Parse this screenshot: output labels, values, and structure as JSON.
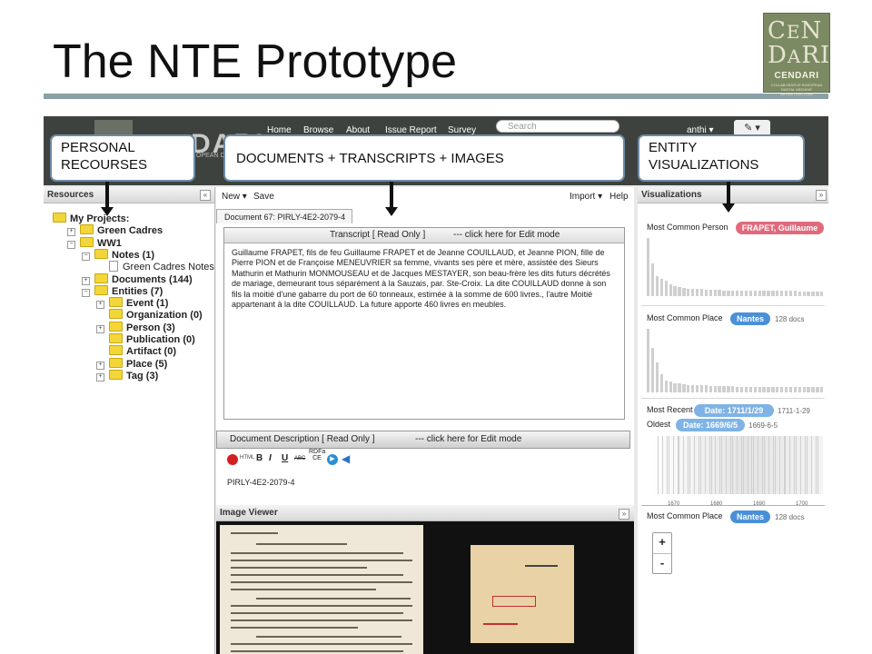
{
  "slide": {
    "title": "The NTE Prototype",
    "logo_word": "CENDARI",
    "logo_sub": "COLLABORATIVE EUROPEAN DIGITAL ARCHIVE INFRASTRUCTURE"
  },
  "app": {
    "brand_text": "DARI",
    "brand_sub": "OPEAN DIGITAL CTURE",
    "nav": [
      "Home",
      "Browse",
      "About",
      "Issue Report",
      "Survey"
    ],
    "search_placeholder": "Search",
    "user": "anthi ▾",
    "edit_button": "✎ ▾"
  },
  "callouts": {
    "personal": "PERSONAL RECOURSES",
    "documents": "DOCUMENTS + TRANSCRIPTS + IMAGES",
    "entity": "ENTITY VISUALIZATIONS"
  },
  "resources": {
    "header": "Resources",
    "collapse": "«",
    "tree": [
      {
        "label": "My Projects:",
        "level": 0,
        "kind": "folder",
        "toggle": ""
      },
      {
        "label": "Green Cadres",
        "level": 1,
        "kind": "folder",
        "toggle": "+"
      },
      {
        "label": "WW1",
        "level": 1,
        "kind": "folder",
        "toggle": "−"
      },
      {
        "label": "Notes (1)",
        "level": 2,
        "kind": "folder",
        "toggle": "−"
      },
      {
        "label": "Green Cadres Notes",
        "level": 3,
        "kind": "doc",
        "toggle": ""
      },
      {
        "label": "Documents (144)",
        "level": 2,
        "kind": "folder",
        "toggle": "+"
      },
      {
        "label": "Entities (7)",
        "level": 2,
        "kind": "folder",
        "toggle": "−"
      },
      {
        "label": "Event (1)",
        "level": 3,
        "kind": "folder",
        "toggle": "+"
      },
      {
        "label": "Organization (0)",
        "level": 3,
        "kind": "folder",
        "toggle": ""
      },
      {
        "label": "Person (3)",
        "level": 3,
        "kind": "folder",
        "toggle": "+"
      },
      {
        "label": "Publication (0)",
        "level": 3,
        "kind": "folder",
        "toggle": ""
      },
      {
        "label": "Artifact (0)",
        "level": 3,
        "kind": "folder",
        "toggle": ""
      },
      {
        "label": "Place (5)",
        "level": 3,
        "kind": "folder",
        "toggle": "+"
      },
      {
        "label": "Tag (3)",
        "level": 3,
        "kind": "folder",
        "toggle": "+"
      }
    ]
  },
  "center": {
    "new_label": "New ▾",
    "save_label": "Save",
    "import_label": "Import ▾",
    "help_label": "Help",
    "doc_tab": "Document 67: PIRLY-4E2-2079-4",
    "transcript_head": "Transcript  [ Read Only ]",
    "edit_prompt": "--- click here for Edit mode",
    "transcript_text": "Guillaume FRAPET, fils de feu Guillaume FRAPET et de Jeanne COUILLAUD, et Jeanne PION, fille de Pierre PION et de Françoise MENEUVRIER sa femme, vivants ses père et mère, assistée des Sieurs Mathurin et Mathurin MONMOUSEAU et de Jacques MESTAYER, son beau-frère les dits futurs décrétés de mariage, demeurant tous séparément à la Sauzais, par. Ste-Croix. La dite COUILLAUD donne à son fils la moitié d'une gabarre du port de 60 tonneaux, estimée à la somme de 600 livres., l'autre Moitié appartenant à la dite COUILLAUD. La future apporte 460 livres en meubles.",
    "desc_head": "Document Description  [ Read Only ]",
    "desc_edit_prompt": "--- click here for Edit mode",
    "desc_text": "PIRLY-4E2-2079-4",
    "image_viewer": "Image Viewer",
    "toolbar_html": "HTML",
    "toolbar_b": "B",
    "toolbar_i": "I",
    "toolbar_u": "U",
    "toolbar_abc": "ABC",
    "toolbar_rdfa": "RDFa CE"
  },
  "visualizations": {
    "header": "Visualizations",
    "collapse": "»",
    "person_label": "Most Common Person",
    "person_pill": "FRAPET, Guillaume",
    "person_color": "#e06a7c",
    "place_label": "Most Common Place",
    "place_pill": "Nantes",
    "place_docs": "128 docs",
    "blue": "#4a90d9",
    "recent_label": "Most Recent",
    "recent_pill": "Date: 1711/1/29",
    "recent_value": "1711-1-29",
    "oldest_label": "Oldest",
    "oldest_pill": "Date: 1669/6/5",
    "oldest_value": "1669-6-5",
    "timeline_ticks": [
      "1670",
      "1680",
      "1690",
      "1700"
    ],
    "place2_label": "Most Common Place",
    "place2_pill": "Nantes",
    "place2_docs": "128 docs",
    "zoom_in": "+",
    "zoom_out": "-",
    "person_bars": [
      100,
      56,
      34,
      30,
      27,
      20,
      17,
      16,
      14,
      13,
      12,
      12,
      12,
      11,
      11,
      11,
      11,
      10,
      10,
      10,
      10,
      10,
      10,
      10,
      10,
      10,
      10,
      10,
      9,
      9,
      9,
      9,
      9,
      9,
      8,
      8,
      8,
      8,
      8,
      8
    ],
    "place_bars": [
      100,
      70,
      47,
      28,
      19,
      17,
      15,
      14,
      13,
      12,
      12,
      11,
      11,
      11,
      10,
      10,
      10,
      10,
      10,
      10,
      9,
      9,
      9,
      9,
      9,
      9,
      9,
      9,
      9,
      9,
      9,
      9,
      9,
      8,
      8,
      8,
      8,
      8,
      8,
      8
    ]
  }
}
